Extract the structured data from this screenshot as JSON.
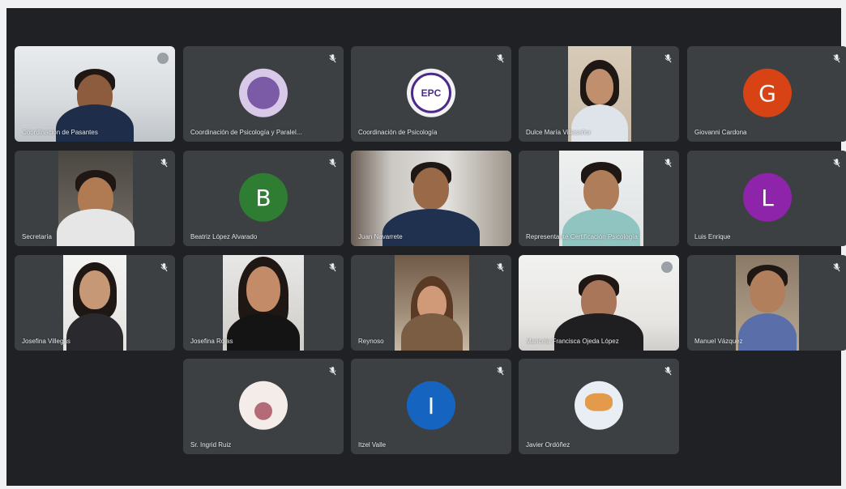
{
  "colors": {
    "screen_bg": "#202124",
    "tile_bg": "#3c4043",
    "avatar_g": "#d84315",
    "avatar_b": "#2e7d32",
    "avatar_l": "#8e24aa",
    "avatar_i": "#1565c0",
    "speaking_ring": "#34d058"
  },
  "participants": [
    {
      "name": "Coordinación de Pasantes",
      "mic": "mic-icon",
      "type": "video"
    },
    {
      "name": "Coordinación de Psicología y Paralel...",
      "mic": "mic-off-icon",
      "type": "logo"
    },
    {
      "name": "Coordinación de Psicología",
      "mic": "mic-off-icon",
      "type": "logo",
      "logo_text": "EPC"
    },
    {
      "name": "Dulce María Villaseñor",
      "mic": "mic-off-icon",
      "type": "video"
    },
    {
      "name": "Giovanni Cardona",
      "mic": "mic-off-icon",
      "type": "avatar",
      "initial": "G"
    },
    {
      "name": "Secretaría",
      "mic": "mic-off-icon",
      "type": "video"
    },
    {
      "name": "Beatriz López Alvarado",
      "mic": "mic-off-icon",
      "type": "avatar",
      "initial": "B"
    },
    {
      "name": "Juan Navarrete",
      "mic": "",
      "type": "video"
    },
    {
      "name": "Representante Certificación Psicología",
      "mic": "mic-off-icon",
      "type": "video"
    },
    {
      "name": "Luis Enrique",
      "mic": "mic-off-icon",
      "type": "avatar",
      "initial": "L"
    },
    {
      "name": "Josefina Villegas",
      "mic": "mic-off-icon",
      "type": "video"
    },
    {
      "name": "Josefina Rojas",
      "mic": "mic-off-icon",
      "type": "video"
    },
    {
      "name": "Reynoso",
      "mic": "mic-off-icon",
      "type": "video"
    },
    {
      "name": "Maricela Francisca Ojeda López",
      "mic": "mic-icon",
      "type": "video"
    },
    {
      "name": "Manuel Vázquez",
      "mic": "mic-off-icon",
      "type": "video"
    },
    {
      "name": "Sr. Ingrid Ruiz",
      "mic": "mic-off-icon",
      "type": "image"
    },
    {
      "name": "Itzel Valle",
      "mic": "mic-off-icon",
      "type": "avatar",
      "initial": "I"
    },
    {
      "name": "Javier Ordóñez",
      "mic": "mic-off-icon",
      "type": "image"
    }
  ]
}
